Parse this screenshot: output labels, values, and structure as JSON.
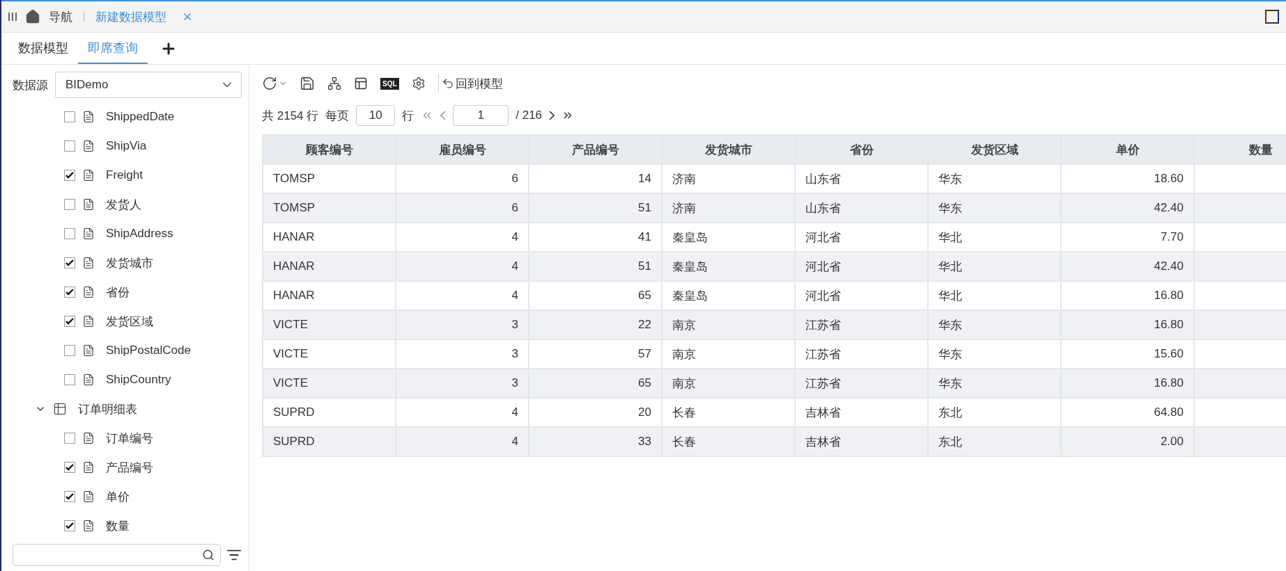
{
  "title_bar": {
    "home_label": "导航",
    "tabs": [
      {
        "label": "新建数据模型",
        "selected": true
      }
    ]
  },
  "tabs": [
    {
      "label": "数据模型",
      "selected": false
    },
    {
      "label": "即席查询",
      "selected": true
    }
  ],
  "datasource": {
    "label": "数据源",
    "value": "BIDemo"
  },
  "tree": [
    {
      "kind": "field",
      "label": "ShippedDate",
      "checked": false
    },
    {
      "kind": "field",
      "label": "ShipVia",
      "checked": false
    },
    {
      "kind": "field",
      "label": "Freight",
      "checked": true
    },
    {
      "kind": "field",
      "label": "发货人",
      "checked": false
    },
    {
      "kind": "field",
      "label": "ShipAddress",
      "checked": false
    },
    {
      "kind": "field",
      "label": "发货城市",
      "checked": true
    },
    {
      "kind": "field",
      "label": "省份",
      "checked": true
    },
    {
      "kind": "field",
      "label": "发货区域",
      "checked": true
    },
    {
      "kind": "field",
      "label": "ShipPostalCode",
      "checked": false
    },
    {
      "kind": "field",
      "label": "ShipCountry",
      "checked": false
    },
    {
      "kind": "table",
      "label": "订单明细表",
      "expanded": true,
      "children": [
        {
          "kind": "field",
          "label": "订单编号",
          "checked": false
        },
        {
          "kind": "field",
          "label": "产品编号",
          "checked": true
        },
        {
          "kind": "field",
          "label": "单价",
          "checked": true
        },
        {
          "kind": "field",
          "label": "数量",
          "checked": true
        }
      ]
    }
  ],
  "toolbar": {
    "sql_badge": "SQL",
    "back_label": "回到模型"
  },
  "pager": {
    "total": "共 2154 行",
    "per_page_label": "每页",
    "per_page": "10",
    "rows_unit": "行",
    "page": "1",
    "page_count": "/ 216"
  },
  "table": {
    "columns": [
      {
        "label": "顾客编号",
        "numeric": false
      },
      {
        "label": "雇员编号",
        "numeric": true
      },
      {
        "label": "产品编号",
        "numeric": true
      },
      {
        "label": "发货城市",
        "numeric": false
      },
      {
        "label": "省份",
        "numeric": false
      },
      {
        "label": "发货区域",
        "numeric": false
      },
      {
        "label": "单价",
        "numeric": true
      },
      {
        "label": "数量"
      }
    ],
    "rows": [
      [
        "TOMSP",
        "6",
        "14",
        "济南",
        "山东省",
        "华东",
        "18.60"
      ],
      [
        "TOMSP",
        "6",
        "51",
        "济南",
        "山东省",
        "华东",
        "42.40"
      ],
      [
        "HANAR",
        "4",
        "41",
        "秦皇岛",
        "河北省",
        "华北",
        "7.70"
      ],
      [
        "HANAR",
        "4",
        "51",
        "秦皇岛",
        "河北省",
        "华北",
        "42.40"
      ],
      [
        "HANAR",
        "4",
        "65",
        "秦皇岛",
        "河北省",
        "华北",
        "16.80"
      ],
      [
        "VICTE",
        "3",
        "22",
        "南京",
        "江苏省",
        "华东",
        "16.80"
      ],
      [
        "VICTE",
        "3",
        "57",
        "南京",
        "江苏省",
        "华东",
        "15.60"
      ],
      [
        "VICTE",
        "3",
        "65",
        "南京",
        "江苏省",
        "华东",
        "16.80"
      ],
      [
        "SUPRD",
        "4",
        "20",
        "长春",
        "吉林省",
        "东北",
        "64.80"
      ],
      [
        "SUPRD",
        "4",
        "33",
        "长春",
        "吉林省",
        "东北",
        "2.00"
      ]
    ]
  }
}
